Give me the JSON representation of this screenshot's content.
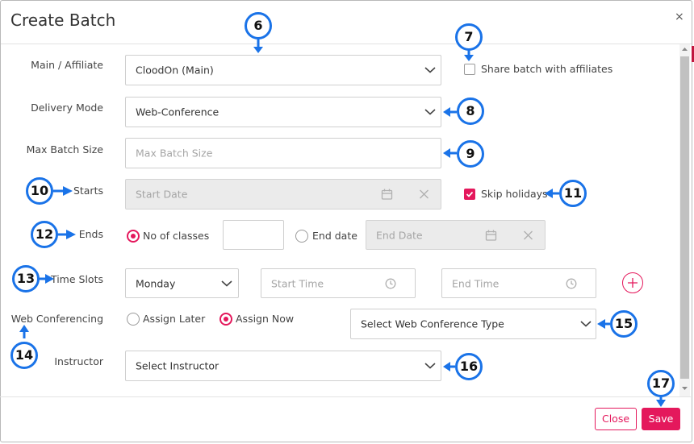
{
  "dialog": {
    "title": "Create Batch",
    "close_glyph": "×"
  },
  "rows": {
    "main_affiliate": {
      "label": "Main / Affiliate",
      "value": "CloodOn (Main)"
    },
    "share": {
      "label": "Share batch with affiliates",
      "checked": false
    },
    "delivery_mode": {
      "label": "Delivery Mode",
      "value": "Web-Conference"
    },
    "max_batch_size": {
      "label": "Max Batch Size",
      "placeholder": "Max Batch Size"
    },
    "starts": {
      "label": "Starts",
      "placeholder": "Start Date"
    },
    "skip_holidays": {
      "label": "Skip holidays",
      "checked": true
    },
    "ends": {
      "label": "Ends",
      "option_classes": "No of classes",
      "option_date": "End date",
      "end_date_placeholder": "End Date",
      "selected": "No of classes"
    },
    "time_slots": {
      "label": "Time Slots",
      "day": "Monday",
      "start_placeholder": "Start Time",
      "end_placeholder": "End Time"
    },
    "web_conferencing": {
      "label": "Web Conferencing",
      "option_later": "Assign Later",
      "option_now": "Assign Now",
      "selected": "Assign Now",
      "type_value": "Select Web Conference Type"
    },
    "instructor": {
      "label": "Instructor",
      "value": "Select Instructor"
    }
  },
  "footer": {
    "close_label": "Close",
    "save_label": "Save"
  },
  "callouts": [
    "6",
    "7",
    "8",
    "9",
    "10",
    "11",
    "12",
    "13",
    "14",
    "15",
    "16",
    "17"
  ],
  "colors": {
    "accent": "#e4185c",
    "callout_border": "#1a73e8"
  },
  "icons": [
    "chevron-down-icon",
    "calendar-icon",
    "clear-x-icon",
    "clock-icon",
    "add-circle-icon",
    "close-icon",
    "check-icon",
    "arrow-pointer-icon"
  ]
}
